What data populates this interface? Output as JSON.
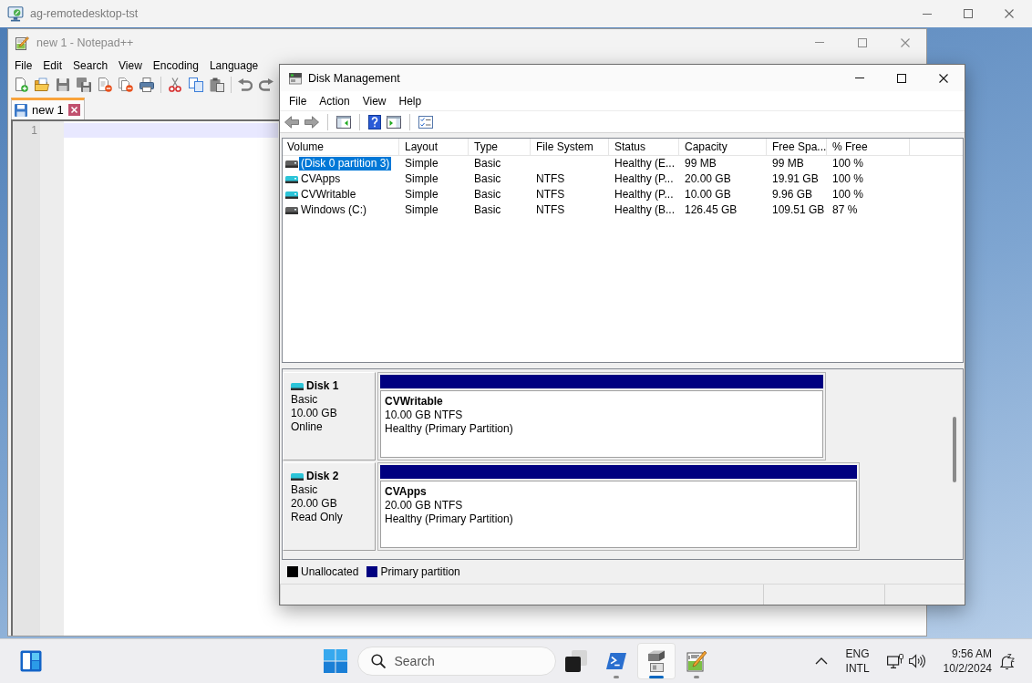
{
  "remote_desktop": {
    "title": "ag-remotedesktop-tst"
  },
  "notepad": {
    "title": "new 1 - Notepad++",
    "menu": [
      "File",
      "Edit",
      "Search",
      "View",
      "Encoding",
      "Language"
    ],
    "tabs": [
      {
        "label": "new 1",
        "selected": true
      }
    ],
    "line_numbers": [
      "1"
    ]
  },
  "disk_management": {
    "title": "Disk Management",
    "menu": [
      "File",
      "Action",
      "View",
      "Help"
    ],
    "volume_table": {
      "columns": [
        "Volume",
        "Layout",
        "Type",
        "File System",
        "Status",
        "Capacity",
        "Free Spa...",
        "% Free"
      ],
      "rows": [
        {
          "selected": true,
          "color": "#5f5f5f",
          "volume": "(Disk 0 partition 3)",
          "layout": "Simple",
          "type": "Basic",
          "status": "Healthy (E...",
          "capacity": "99 MB",
          "free_space": "99 MB",
          "percent_free": "100 %"
        },
        {
          "selected": false,
          "color": "#2cc4d8",
          "volume": "CVApps",
          "layout": "Simple",
          "type": "Basic",
          "file_system": "NTFS",
          "status": "Healthy (P...",
          "capacity": "20.00 GB",
          "free_space": "19.91 GB",
          "percent_free": "100 %"
        },
        {
          "selected": false,
          "color": "#2cc4d8",
          "volume": "CVWritable",
          "layout": "Simple",
          "type": "Basic",
          "file_system": "NTFS",
          "status": "Healthy (P...",
          "capacity": "10.00 GB",
          "free_space": "9.96 GB",
          "percent_free": "100 %"
        },
        {
          "selected": false,
          "color": "#5f5f5f",
          "volume": "Windows (C:)",
          "layout": "Simple",
          "type": "Basic",
          "file_system": "NTFS",
          "status": "Healthy (B...",
          "capacity": "126.45 GB",
          "free_space": "109.51 GB",
          "percent_free": "87 %"
        }
      ]
    },
    "disks": [
      {
        "name": "Disk 1",
        "type": "Basic",
        "size": "10.00 GB",
        "status": "Online",
        "partitions": [
          {
            "kind": "primary",
            "name": "CVWritable",
            "size": "10.00 GB NTFS",
            "status": "Healthy (Primary Partition)"
          }
        ]
      },
      {
        "name": "Disk 2",
        "type": "Basic",
        "size": "20.00 GB",
        "status": "Read Only",
        "partitions": [
          {
            "kind": "primary",
            "name": "CVApps",
            "size": "20.00 GB NTFS",
            "status": "Healthy (Primary Partition)"
          }
        ]
      }
    ],
    "legend": [
      {
        "kind": "unallocated",
        "label": "Unallocated",
        "color": "#000000"
      },
      {
        "kind": "primary",
        "label": "Primary partition",
        "color": "#000080"
      }
    ]
  },
  "taskbar": {
    "search": {
      "placeholder": "Search"
    },
    "apps": [
      {
        "kind": "terminal",
        "running": true,
        "active": false
      },
      {
        "kind": "disk-management",
        "running": true,
        "active": true
      },
      {
        "kind": "notepad",
        "running": true,
        "active": false
      }
    ],
    "language": [
      "ENG",
      "INTL"
    ],
    "clock": {
      "time": "9:56 AM",
      "date": "10/2/2024"
    }
  }
}
